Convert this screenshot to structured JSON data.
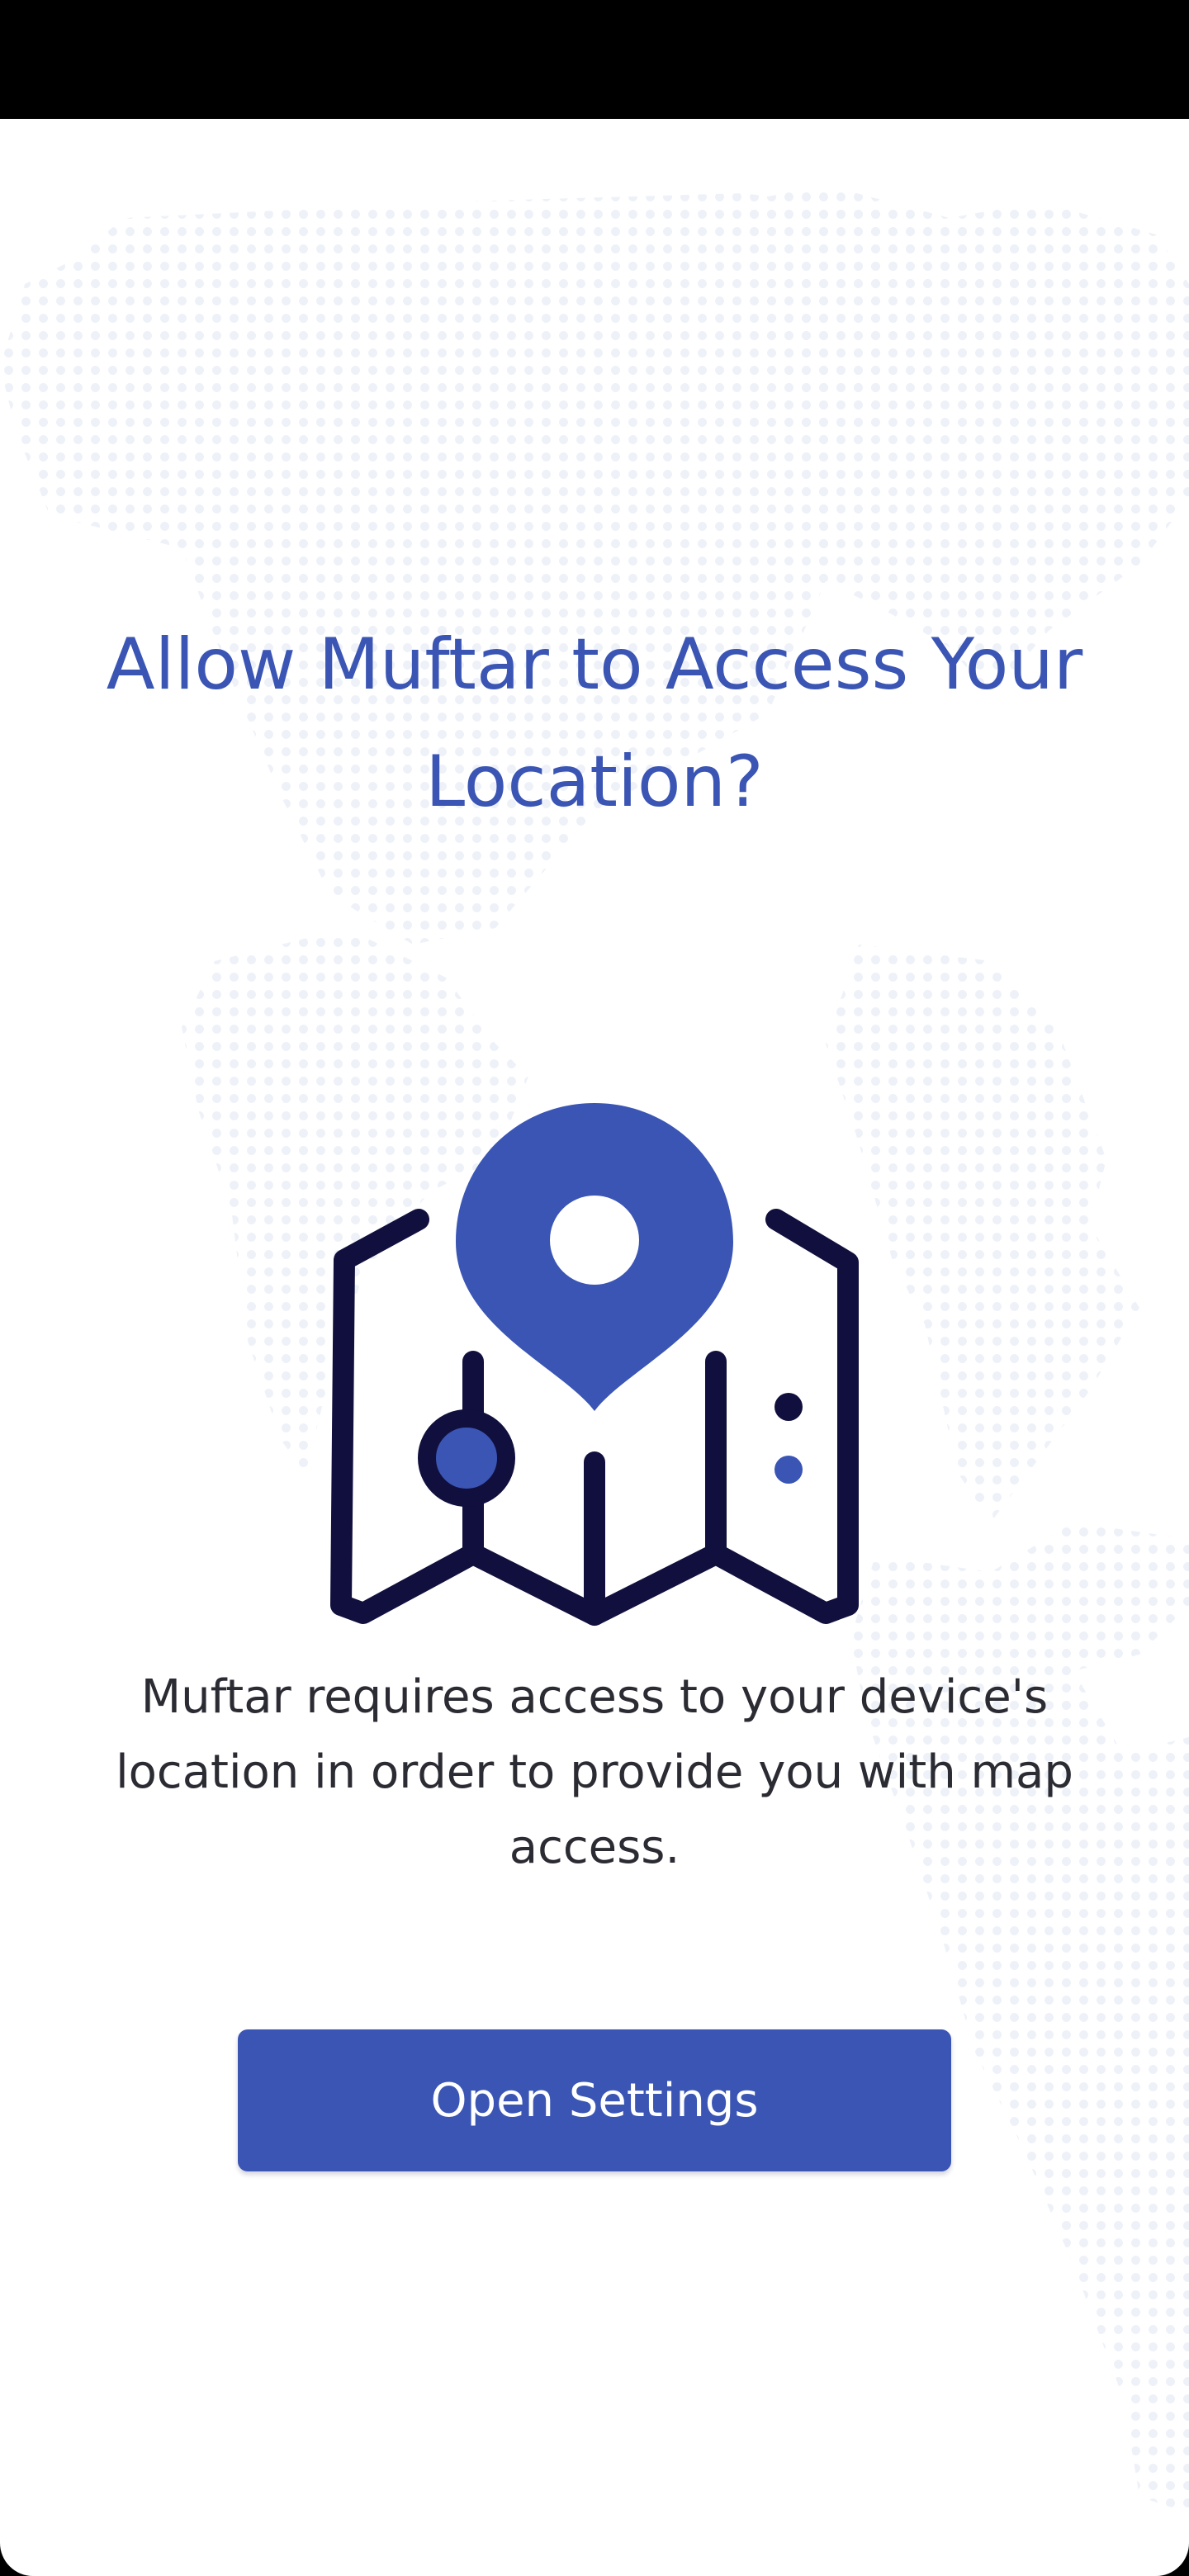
{
  "permission_prompt": {
    "title": "Allow Muftar to Access Your Location?",
    "description": "Muftar requires access to your device's location in order to provide you with map access.",
    "button_label": "Open Settings"
  },
  "icons": {
    "illustration": "map-location-pin-icon",
    "background": "dotted-world-map"
  },
  "colors": {
    "accent": "#3a55b4",
    "outline": "#110f3d",
    "body_text": "#2b2b33",
    "background": "#ffffff",
    "map_dots": "#eef2f8"
  }
}
